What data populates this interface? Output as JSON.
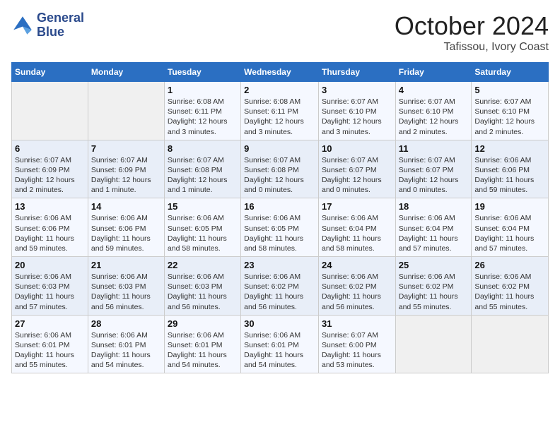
{
  "header": {
    "logo_line1": "General",
    "logo_line2": "Blue",
    "month": "October 2024",
    "location": "Tafissou, Ivory Coast"
  },
  "weekdays": [
    "Sunday",
    "Monday",
    "Tuesday",
    "Wednesday",
    "Thursday",
    "Friday",
    "Saturday"
  ],
  "weeks": [
    [
      {
        "num": "",
        "info": ""
      },
      {
        "num": "",
        "info": ""
      },
      {
        "num": "1",
        "info": "Sunrise: 6:08 AM\nSunset: 6:11 PM\nDaylight: 12 hours and 3 minutes."
      },
      {
        "num": "2",
        "info": "Sunrise: 6:08 AM\nSunset: 6:11 PM\nDaylight: 12 hours and 3 minutes."
      },
      {
        "num": "3",
        "info": "Sunrise: 6:07 AM\nSunset: 6:10 PM\nDaylight: 12 hours and 3 minutes."
      },
      {
        "num": "4",
        "info": "Sunrise: 6:07 AM\nSunset: 6:10 PM\nDaylight: 12 hours and 2 minutes."
      },
      {
        "num": "5",
        "info": "Sunrise: 6:07 AM\nSunset: 6:10 PM\nDaylight: 12 hours and 2 minutes."
      }
    ],
    [
      {
        "num": "6",
        "info": "Sunrise: 6:07 AM\nSunset: 6:09 PM\nDaylight: 12 hours and 2 minutes."
      },
      {
        "num": "7",
        "info": "Sunrise: 6:07 AM\nSunset: 6:09 PM\nDaylight: 12 hours and 1 minute."
      },
      {
        "num": "8",
        "info": "Sunrise: 6:07 AM\nSunset: 6:08 PM\nDaylight: 12 hours and 1 minute."
      },
      {
        "num": "9",
        "info": "Sunrise: 6:07 AM\nSunset: 6:08 PM\nDaylight: 12 hours and 0 minutes."
      },
      {
        "num": "10",
        "info": "Sunrise: 6:07 AM\nSunset: 6:07 PM\nDaylight: 12 hours and 0 minutes."
      },
      {
        "num": "11",
        "info": "Sunrise: 6:07 AM\nSunset: 6:07 PM\nDaylight: 12 hours and 0 minutes."
      },
      {
        "num": "12",
        "info": "Sunrise: 6:06 AM\nSunset: 6:06 PM\nDaylight: 11 hours and 59 minutes."
      }
    ],
    [
      {
        "num": "13",
        "info": "Sunrise: 6:06 AM\nSunset: 6:06 PM\nDaylight: 11 hours and 59 minutes."
      },
      {
        "num": "14",
        "info": "Sunrise: 6:06 AM\nSunset: 6:06 PM\nDaylight: 11 hours and 59 minutes."
      },
      {
        "num": "15",
        "info": "Sunrise: 6:06 AM\nSunset: 6:05 PM\nDaylight: 11 hours and 58 minutes."
      },
      {
        "num": "16",
        "info": "Sunrise: 6:06 AM\nSunset: 6:05 PM\nDaylight: 11 hours and 58 minutes."
      },
      {
        "num": "17",
        "info": "Sunrise: 6:06 AM\nSunset: 6:04 PM\nDaylight: 11 hours and 58 minutes."
      },
      {
        "num": "18",
        "info": "Sunrise: 6:06 AM\nSunset: 6:04 PM\nDaylight: 11 hours and 57 minutes."
      },
      {
        "num": "19",
        "info": "Sunrise: 6:06 AM\nSunset: 6:04 PM\nDaylight: 11 hours and 57 minutes."
      }
    ],
    [
      {
        "num": "20",
        "info": "Sunrise: 6:06 AM\nSunset: 6:03 PM\nDaylight: 11 hours and 57 minutes."
      },
      {
        "num": "21",
        "info": "Sunrise: 6:06 AM\nSunset: 6:03 PM\nDaylight: 11 hours and 56 minutes."
      },
      {
        "num": "22",
        "info": "Sunrise: 6:06 AM\nSunset: 6:03 PM\nDaylight: 11 hours and 56 minutes."
      },
      {
        "num": "23",
        "info": "Sunrise: 6:06 AM\nSunset: 6:02 PM\nDaylight: 11 hours and 56 minutes."
      },
      {
        "num": "24",
        "info": "Sunrise: 6:06 AM\nSunset: 6:02 PM\nDaylight: 11 hours and 56 minutes."
      },
      {
        "num": "25",
        "info": "Sunrise: 6:06 AM\nSunset: 6:02 PM\nDaylight: 11 hours and 55 minutes."
      },
      {
        "num": "26",
        "info": "Sunrise: 6:06 AM\nSunset: 6:02 PM\nDaylight: 11 hours and 55 minutes."
      }
    ],
    [
      {
        "num": "27",
        "info": "Sunrise: 6:06 AM\nSunset: 6:01 PM\nDaylight: 11 hours and 55 minutes."
      },
      {
        "num": "28",
        "info": "Sunrise: 6:06 AM\nSunset: 6:01 PM\nDaylight: 11 hours and 54 minutes."
      },
      {
        "num": "29",
        "info": "Sunrise: 6:06 AM\nSunset: 6:01 PM\nDaylight: 11 hours and 54 minutes."
      },
      {
        "num": "30",
        "info": "Sunrise: 6:06 AM\nSunset: 6:01 PM\nDaylight: 11 hours and 54 minutes."
      },
      {
        "num": "31",
        "info": "Sunrise: 6:07 AM\nSunset: 6:00 PM\nDaylight: 11 hours and 53 minutes."
      },
      {
        "num": "",
        "info": ""
      },
      {
        "num": "",
        "info": ""
      }
    ]
  ]
}
